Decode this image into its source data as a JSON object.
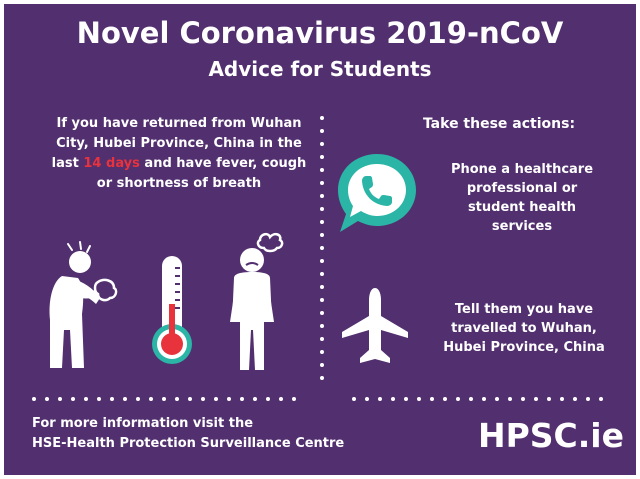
{
  "title": "Novel Coronavirus 2019-nCoV",
  "subtitle": "Advice for Students",
  "returned_notice": {
    "before": "If you have returned from Wuhan City, Hubei Province, China in the last ",
    "highlight": "14 days",
    "after": " and have fever, cough or shortness of breath"
  },
  "actions": {
    "heading": "Take these actions:",
    "items": [
      {
        "icon": "phone-chat-icon",
        "text": "Phone a healthcare professional or student health services"
      },
      {
        "icon": "airplane-icon",
        "text": "Tell them you have travelled to Wuhan, Hubei Province, China"
      }
    ]
  },
  "footer": {
    "line1": "For more information visit the",
    "line2": "HSE-Health Protection Surveillance Centre"
  },
  "brand": "HPSC.ie",
  "icons": [
    "coughing-person-icon",
    "thermometer-icon",
    "unwell-person-icon",
    "phone-chat-icon",
    "airplane-icon"
  ],
  "colors": {
    "background": "#522f6e",
    "text": "#ffffff",
    "highlight": "#e8323c",
    "teal": "#2bb5a6"
  }
}
